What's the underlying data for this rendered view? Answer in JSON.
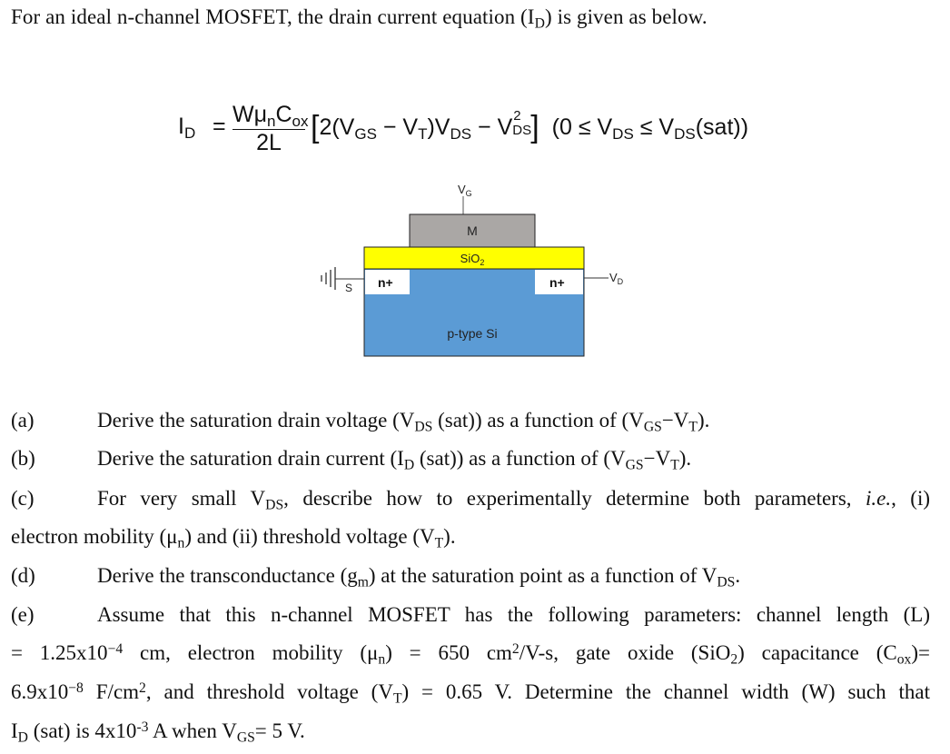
{
  "intro": "For an ideal n-channel MOSFET, the drain current equation (I_D) is given as below.",
  "intro_parts": {
    "a": "For an ideal n-channel MOSFET, the drain current equation (I",
    "sub": "D",
    "b": ") is given as below."
  },
  "equation": {
    "lhs": "I",
    "lhs_sub": "D",
    "equals": "=",
    "numerator": {
      "w": "W",
      "mu": "μ",
      "mu_sub": "n",
      "c": "C",
      "c_sub": "ox"
    },
    "denominator": "2L",
    "bracket_content": {
      "p1": "2(V",
      "gs": "GS",
      "p2": " − V",
      "t": "T",
      "p3": ")V",
      "ds": "DS",
      "p4": " − V",
      "sq": "2",
      "ds2": "DS"
    },
    "condition": {
      "p1": "(0 ≤ V",
      "ds": "DS",
      "p2": " ≤ V",
      "ds2": "DS",
      "p3": "(sat))"
    }
  },
  "diagram": {
    "gate_terminal": "V",
    "gate_sub": "G",
    "metal": "M",
    "oxide": "SiO",
    "oxide_sub": "2",
    "source_region": "n+",
    "drain_region": "n+",
    "source_label": "S",
    "drain_terminal": "V",
    "drain_sub": "D",
    "substrate": "p-type Si",
    "colors": {
      "metal": "#aaa7a5",
      "oxide": "#ffff00",
      "substrate": "#5b9bd5",
      "n_plus": "#ffffff"
    }
  },
  "questions": [
    {
      "label": "(a)",
      "text": "Derive the saturation drain voltage (V_DS (sat)) as a function of (V_GS−V_T)."
    },
    {
      "label": "(b)",
      "text": "Derive the saturation drain current (I_D (sat)) as a function of (V_GS−V_T)."
    },
    {
      "label": "(c)",
      "text": "For very small V_DS, describe how to experimentally determine both parameters, i.e., (i) electron mobility (μ_n) and (ii) threshold voltage (V_T)."
    },
    {
      "label": "(d)",
      "text": "Derive the transconductance (g_m) at the saturation point as a function of V_DS."
    },
    {
      "label": "(e)",
      "text": "Assume that this n-channel MOSFET has the following parameters: channel length (L) = 1.25x10^−4 cm, electron mobility (μ_n) = 650 cm²/V-s, gate oxide (SiO₂) capacitance (C_ox)= 6.9x10^−8 F/cm², and threshold voltage (V_T) = 0.65 V. Determine the channel width (W) such that I_D (sat) is 4x10^-3 A when V_GS= 5 V."
    }
  ],
  "q": {
    "a": {
      "label": "(a)",
      "t1": "Derive the saturation drain voltage (V",
      "s1": "DS",
      "t2": " (sat)) as a function of (V",
      "s2": "GS",
      "t3": "−V",
      "s3": "T",
      "t4": ")."
    },
    "b": {
      "label": "(b)",
      "t1": "Derive the saturation drain current (I",
      "s1": "D",
      "t2": " (sat)) as a function of (V",
      "s2": "GS",
      "t3": "−V",
      "s3": "T",
      "t4": ")."
    },
    "c": {
      "label": "(c)",
      "w": [
        "For",
        "very",
        "small",
        "V_DS,",
        "describe",
        "how",
        "to",
        "experimentally",
        "determine",
        "both",
        "parameters,",
        "i.e.,",
        "(i)"
      ],
      "t1": "For very small V",
      "s1": "DS",
      "t2": ", describe how to experimentally determine both parameters, ",
      "it": "i.e.",
      "t3": ", (i)",
      "l2a": "electron mobility (μ",
      "l2s": "n",
      "l2b": ") and (ii) threshold voltage (V",
      "l2s2": "T",
      "l2c": ")."
    },
    "d": {
      "label": "(d)",
      "t1": "Derive the transconductance (g",
      "s1": "m",
      "t2": ") at the saturation point as a function of V",
      "s2": "DS",
      "t3": "."
    },
    "e": {
      "label": "(e)",
      "l1": "Assume that this n-channel MOSFET has the following parameters: channel length (L)",
      "l2a": "= 1.25x10",
      "l2e": "−4",
      "l2b": " cm, electron mobility (μ",
      "l2s": "n",
      "l2c": ") = 650 cm",
      "l2e2": "2",
      "l2d": "/V-s, gate oxide (SiO",
      "l2s2": "2",
      "l2f": ") capacitance (C",
      "l2s3": "ox",
      "l2g": ")=",
      "l3a": "6.9x10",
      "l3e": "−8",
      "l3b": " F/cm",
      "l3e2": "2",
      "l3c": ", and threshold voltage (V",
      "l3s": "T",
      "l3d": ") = 0.65 V. Determine the channel width (W) such that",
      "l4a": "I",
      "l4s": "D",
      "l4b": " (sat) is 4x10",
      "l4e": "-3",
      "l4c": " A when V",
      "l4s2": "GS",
      "l4d": "= 5 V."
    }
  }
}
